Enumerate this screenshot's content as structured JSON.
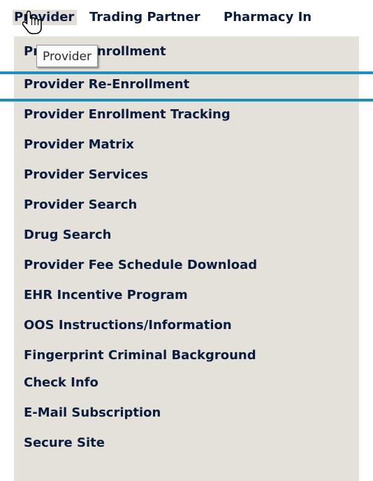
{
  "menubar": {
    "items": [
      {
        "label": "Provider"
      },
      {
        "label": "Trading Partner"
      },
      {
        "label": "Pharmacy In"
      }
    ]
  },
  "dropdown": {
    "items": [
      {
        "label": "Provider Enrollment"
      },
      {
        "label": "Provider Re-Enrollment"
      },
      {
        "label": "Provider Enrollment Tracking"
      },
      {
        "label": "Provider Matrix"
      },
      {
        "label": "Provider Services"
      },
      {
        "label": "Provider Search"
      },
      {
        "label": "Drug Search"
      },
      {
        "label": "Provider Fee Schedule Download"
      },
      {
        "label": "EHR Incentive Program"
      },
      {
        "label": "OOS Instructions/Information"
      },
      {
        "label": "Fingerprint Criminal Background"
      },
      {
        "label": "Check Info"
      },
      {
        "label": "E-Mail Subscription"
      },
      {
        "label": "Secure Site"
      }
    ]
  },
  "tooltip": {
    "text": "Provider"
  },
  "cursor": {
    "icon": "hand-pointer-icon"
  },
  "colors": {
    "menu_background": "#e3e1d9",
    "text": "#0a1b3d",
    "highlight_lines": "#1e8fba"
  }
}
